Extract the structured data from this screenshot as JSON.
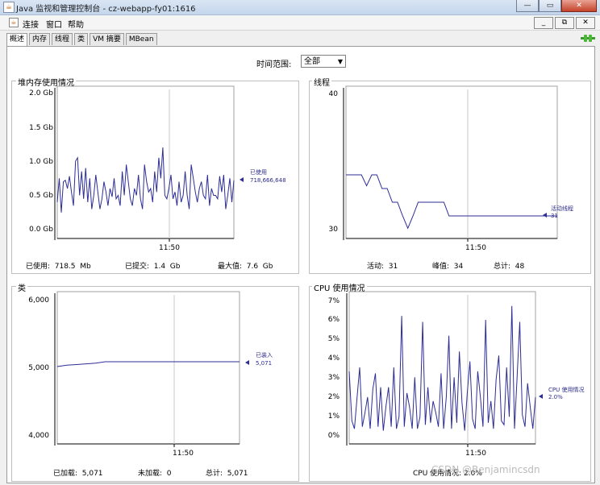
{
  "window": {
    "title": "Java 监视和管理控制台 - cz-webapp-fy01:1616"
  },
  "menu": [
    "连接",
    "窗口",
    "帮助"
  ],
  "tabs": [
    "概述",
    "内存",
    "线程",
    "类",
    "VM 摘要",
    "MBean"
  ],
  "time_range": {
    "label": "时间范围:",
    "value": "全部"
  },
  "watermark": "CSDN @Benjamincsdn",
  "panels": {
    "heap": {
      "title": "堆内存使用情况",
      "y_ticks": [
        "2.0 Gb",
        "1.5 Gb",
        "1.0 Gb",
        "0.5 Gb",
        "0.0 Gb"
      ],
      "x_tick": "11:50",
      "legend_label": "已使用",
      "legend_value": "718,666,648",
      "stats": [
        "已使用:  718.5  Mb",
        "已提交:  1.4  Gb",
        "最大值:  7.6  Gb"
      ]
    },
    "threads": {
      "title": "线程",
      "y_ticks": [
        "40",
        "30"
      ],
      "x_tick": "11:50",
      "legend_label": "活动线程",
      "legend_value": "31",
      "stats": [
        "活动:  31",
        "峰值:  34",
        "总计:  48"
      ]
    },
    "classes": {
      "title": "类",
      "y_ticks": [
        "6,000",
        "5,000",
        "4,000"
      ],
      "x_tick": "11:50",
      "legend_label": "已装入",
      "legend_value": "5,071",
      "stats": [
        "已加载:  5,071",
        "未加载:  0",
        "总计:  5,071"
      ]
    },
    "cpu": {
      "title": "CPU 使用情况",
      "y_ticks": [
        "7%",
        "6%",
        "5%",
        "4%",
        "3%",
        "2%",
        "1%",
        "0%"
      ],
      "x_tick": "11:50",
      "legend_label": "CPU 使用情况",
      "legend_value": "2.0%",
      "stats": [
        "CPU 使用情况: 2.0%"
      ]
    }
  },
  "chart_data": [
    {
      "type": "line",
      "title": "堆内存使用情况",
      "ylabel": "Gb",
      "ylim": [
        0,
        2.0
      ],
      "grid": true,
      "series": [
        {
          "name": "已使用",
          "values": [
            0.4,
            0.75,
            0.25,
            0.7,
            0.72,
            0.6,
            0.78,
            0.55,
            0.35,
            1.0,
            1.05,
            0.5,
            0.85,
            0.45,
            0.9,
            0.4,
            0.75,
            0.3,
            0.5,
            0.8,
            0.55,
            0.3,
            0.45,
            0.7,
            0.55,
            0.35,
            0.6,
            0.48,
            0.75,
            0.45,
            0.5,
            0.35,
            0.85,
            0.5,
            0.95,
            0.7,
            0.45,
            0.35,
            0.6,
            0.5,
            0.8,
            0.45,
            0.3,
            0.95,
            0.7,
            0.55,
            0.6,
            0.4,
            0.85,
            0.55,
            1.05,
            0.75,
            1.2,
            0.5,
            0.45,
            0.6,
            0.8,
            0.45,
            0.55,
            0.35,
            0.7,
            0.4,
            0.5,
            0.85,
            0.5,
            0.3,
            0.95,
            0.75,
            0.55,
            0.4,
            0.6,
            0.7,
            0.5,
            0.45,
            0.8,
            0.35,
            0.6,
            0.5,
            0.5,
            0.45,
            0.78,
            0.55,
            0.8,
            0.3,
            0.5,
            0.75,
            0.4,
            0.72
          ]
        }
      ]
    },
    {
      "type": "line",
      "title": "线程",
      "ylim": [
        30,
        40
      ],
      "grid": true,
      "series": [
        {
          "name": "活动线程",
          "values": [
            34,
            34,
            34,
            34,
            33.2,
            34,
            34,
            33,
            33,
            32,
            32,
            31,
            30.1,
            31,
            32,
            32,
            32,
            32,
            32,
            32,
            31,
            31,
            31,
            31,
            31,
            31,
            31,
            31,
            31,
            31,
            31,
            31,
            31,
            31,
            31,
            31,
            31,
            31,
            31,
            31,
            31,
            31
          ]
        }
      ]
    },
    {
      "type": "line",
      "title": "类",
      "ylim": [
        4000,
        6000
      ],
      "grid": true,
      "series": [
        {
          "name": "已装入",
          "values": [
            5000,
            5020,
            5030,
            5040,
            5050,
            5071,
            5071,
            5071,
            5071,
            5071,
            5071,
            5071,
            5071,
            5071,
            5071,
            5071,
            5071,
            5071,
            5071,
            5071
          ]
        }
      ]
    },
    {
      "type": "line",
      "title": "CPU 使用情况",
      "ylabel": "%",
      "ylim": [
        0,
        7
      ],
      "grid": true,
      "series": [
        {
          "name": "CPU 使用情况",
          "values": [
            3.3,
            0.8,
            0.4,
            2.0,
            3.5,
            0.5,
            1.2,
            2.0,
            0.4,
            2.4,
            3.2,
            0.5,
            2.5,
            0.3,
            1.5,
            2.5,
            0.5,
            3.5,
            0.4,
            1.0,
            6.1,
            0.5,
            2.2,
            1.5,
            0.4,
            3.0,
            0.4,
            1.0,
            5.8,
            0.6,
            2.5,
            0.7,
            1.8,
            1.2,
            0.5,
            3.2,
            0.4,
            2.0,
            5.1,
            0.4,
            3.0,
            0.7,
            4.3,
            1.7,
            0.3,
            2.2,
            3.8,
            0.9,
            0.4,
            3.3,
            2.0,
            0.5,
            5.9,
            0.7,
            1.8,
            0.4,
            2.9,
            4.1,
            0.8,
            0.6,
            3.5,
            1.0,
            6.6,
            0.4,
            3.0,
            5.8,
            1.1,
            0.5,
            2.7,
            1.5,
            0.4,
            2.0
          ]
        }
      ]
    }
  ]
}
